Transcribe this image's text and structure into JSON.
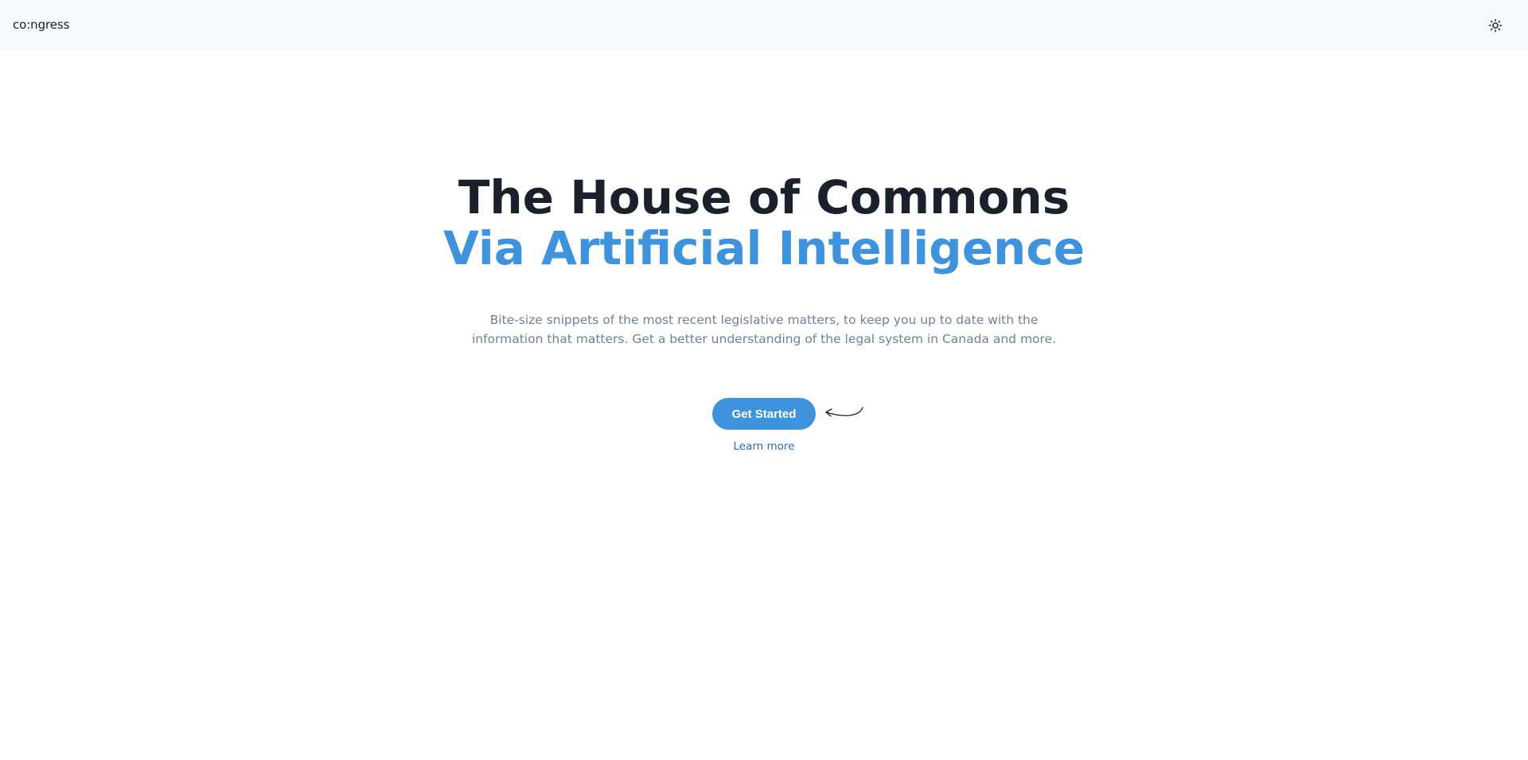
{
  "header": {
    "brand": "co:ngress",
    "theme_toggle_icon": "sun-icon"
  },
  "hero": {
    "title_line1": "The House of Commons",
    "title_line2": "Via Artificial Intelligence",
    "subtitle": "Bite-size snippets of the most recent legislative matters, to keep you up to date with the information that matters. Get a better understanding of the legal system in Canada and more.",
    "cta_label": "Get Started",
    "cta_icon": "curved-arrow-icon",
    "secondary_link": "Learn more"
  },
  "colors": {
    "accent": "#3f92dc",
    "heading": "#1a202c",
    "muted": "#718096",
    "link": "#2b6cb0",
    "header_bg": "#f5f9fc"
  }
}
